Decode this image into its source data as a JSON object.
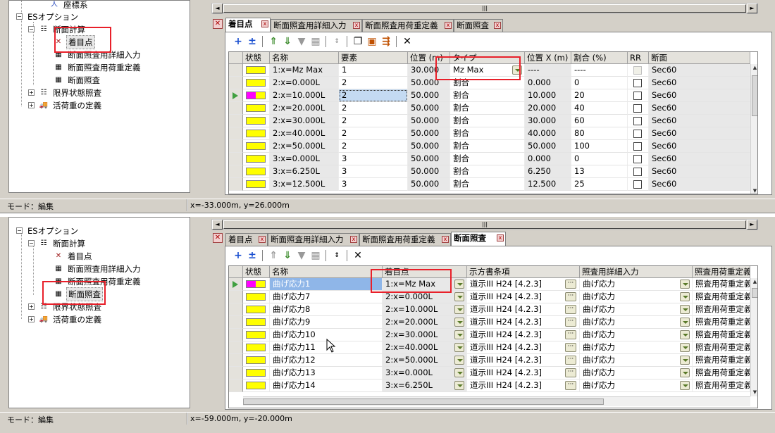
{
  "tree": {
    "zahyo": "座標系",
    "es": "ESオプション",
    "danmen_keisan": "断面計算",
    "chakumoku": "着目点",
    "detail_input": "断面照査用詳細入力",
    "load_def": "断面照査用荷重定義",
    "check": "断面照査",
    "genkai": "限界状態照査",
    "katsukaju": "活荷重の定義"
  },
  "tabs": [
    "着目点",
    "断面照査用詳細入力",
    "断面照査用荷重定義",
    "断面照査"
  ],
  "status": {
    "mode": "モード：編集",
    "coord1": "x=-33.000m, y=26.000m",
    "coord2": "x=-59.000m, y=-20.000m"
  },
  "grid1": {
    "headers": [
      "状態",
      "名称",
      "要素",
      "位置 (m)",
      "タイプ",
      "位置 X (m)",
      "割合 (%)",
      "RR",
      "断面"
    ],
    "rows": [
      {
        "name": "1:x=Mz Max",
        "elem": "1",
        "pos": "30.000",
        "type": "Mz Max",
        "posx": "----",
        "ratio": "----",
        "section": "Sec60"
      },
      {
        "name": "2:x=0.000L",
        "elem": "2",
        "pos": "50.000",
        "type": "割合",
        "posx": "0.000",
        "ratio": "0",
        "section": "Sec60"
      },
      {
        "name": "2:x=10.000L",
        "elem": "2",
        "pos": "50.000",
        "type": "割合",
        "posx": "10.000",
        "ratio": "20",
        "section": "Sec60"
      },
      {
        "name": "2:x=20.000L",
        "elem": "2",
        "pos": "50.000",
        "type": "割合",
        "posx": "20.000",
        "ratio": "40",
        "section": "Sec60"
      },
      {
        "name": "2:x=30.000L",
        "elem": "2",
        "pos": "50.000",
        "type": "割合",
        "posx": "30.000",
        "ratio": "60",
        "section": "Sec60"
      },
      {
        "name": "2:x=40.000L",
        "elem": "2",
        "pos": "50.000",
        "type": "割合",
        "posx": "40.000",
        "ratio": "80",
        "section": "Sec60"
      },
      {
        "name": "2:x=50.000L",
        "elem": "2",
        "pos": "50.000",
        "type": "割合",
        "posx": "50.000",
        "ratio": "100",
        "section": "Sec60"
      },
      {
        "name": "3:x=0.000L",
        "elem": "3",
        "pos": "50.000",
        "type": "割合",
        "posx": "0.000",
        "ratio": "0",
        "section": "Sec60"
      },
      {
        "name": "3:x=6.250L",
        "elem": "3",
        "pos": "50.000",
        "type": "割合",
        "posx": "6.250",
        "ratio": "13",
        "section": "Sec60"
      },
      {
        "name": "3:x=12.500L",
        "elem": "3",
        "pos": "50.000",
        "type": "割合",
        "posx": "12.500",
        "ratio": "25",
        "section": "Sec60"
      }
    ]
  },
  "grid2": {
    "headers": [
      "状態",
      "名称",
      "着目点",
      "示方書条項",
      "照査用詳細入力",
      "照査用荷重定義"
    ],
    "rows": [
      {
        "name": "曲げ応力1",
        "point": "1:x=Mz Max",
        "clause": "道示III H24 [4.2.3]",
        "detail": "曲げ応力",
        "load": "照査用荷重定義"
      },
      {
        "name": "曲げ応力7",
        "point": "2:x=0.000L",
        "clause": "道示III H24 [4.2.3]",
        "detail": "曲げ応力",
        "load": "照査用荷重定義"
      },
      {
        "name": "曲げ応力8",
        "point": "2:x=10.000L",
        "clause": "道示III H24 [4.2.3]",
        "detail": "曲げ応力",
        "load": "照査用荷重定義"
      },
      {
        "name": "曲げ応力9",
        "point": "2:x=20.000L",
        "clause": "道示III H24 [4.2.3]",
        "detail": "曲げ応力",
        "load": "照査用荷重定義"
      },
      {
        "name": "曲げ応力10",
        "point": "2:x=30.000L",
        "clause": "道示III H24 [4.2.3]",
        "detail": "曲げ応力",
        "load": "照査用荷重定義"
      },
      {
        "name": "曲げ応力11",
        "point": "2:x=40.000L",
        "clause": "道示III H24 [4.2.3]",
        "detail": "曲げ応力",
        "load": "照査用荷重定義"
      },
      {
        "name": "曲げ応力12",
        "point": "2:x=50.000L",
        "clause": "道示III H24 [4.2.3]",
        "detail": "曲げ応力",
        "load": "照査用荷重定義"
      },
      {
        "name": "曲げ応力13",
        "point": "3:x=0.000L",
        "clause": "道示III H24 [4.2.3]",
        "detail": "曲げ応力",
        "load": "照査用荷重定義"
      },
      {
        "name": "曲げ応力14",
        "point": "3:x=6.250L",
        "clause": "道示III H24 [4.2.3]",
        "detail": "曲げ応力",
        "load": "照査用荷重定義"
      }
    ]
  },
  "colors": {
    "status_yellow": "#ffff00",
    "status_magenta": "#ff00ff",
    "highlight_red": "#e8202a"
  }
}
